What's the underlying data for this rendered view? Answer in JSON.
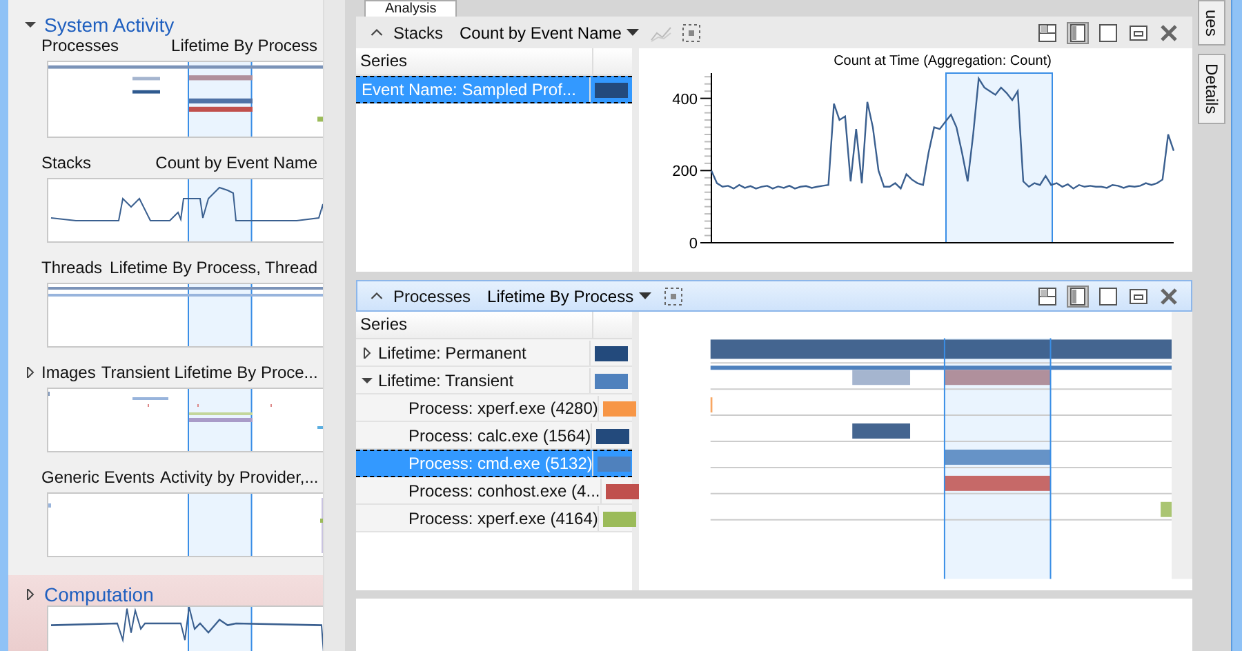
{
  "analysis_tab": {
    "label": "Analysis"
  },
  "graph_explorer": {
    "groups": [
      {
        "title": "System Activity",
        "expanded": true,
        "highlighted": false,
        "graphs": [
          {
            "kind": "processes",
            "title": "Processes",
            "preset": "Lifetime By Process",
            "expandable": false
          },
          {
            "kind": "stacks",
            "title": "Stacks",
            "preset": "Count by Event Name",
            "expandable": false
          },
          {
            "kind": "threads",
            "title": "Threads",
            "preset": "Lifetime By Process, Thread",
            "expandable": false
          },
          {
            "kind": "images",
            "title": "Images",
            "preset": "Transient Lifetime By Proce...",
            "expandable": true
          },
          {
            "kind": "events",
            "title": "Generic Events",
            "preset": "Activity by Provider,...",
            "expandable": false
          }
        ]
      },
      {
        "title": "Computation",
        "expanded": false,
        "highlighted": true,
        "preview": {
          "kind": "computation"
        }
      }
    ]
  },
  "stacks_panel": {
    "title": "Stacks",
    "preset": "Count by Event Name",
    "active": false,
    "table": {
      "column": "Series",
      "rows": [
        {
          "label": "Event Name: Sampled Prof...",
          "color": "#234a7c",
          "selected": true
        }
      ]
    },
    "chart_data": {
      "type": "line",
      "title": "Count at Time (Aggregation: Count)",
      "ylim": [
        0,
        470
      ],
      "yticks": [
        0,
        200,
        400
      ],
      "series": [
        {
          "color": "#3a5f8f",
          "values": [
            200,
            165,
            155,
            158,
            150,
            160,
            152,
            157,
            150,
            155,
            158,
            150,
            156,
            152,
            158,
            150,
            155,
            157,
            152,
            155,
            158,
            160,
            385,
            340,
            350,
            170,
            315,
            165,
            390,
            320,
            200,
            155,
            155,
            165,
            150,
            190,
            175,
            165,
            160,
            250,
            320,
            315,
            335,
            355,
            320,
            250,
            170,
            300,
            455,
            430,
            420,
            410,
            430,
            415,
            395,
            420,
            170,
            155,
            165,
            160,
            185,
            160,
            165,
            155,
            162,
            150,
            160,
            155,
            158,
            155,
            155,
            152,
            160,
            158,
            152,
            157,
            155,
            158,
            165,
            160,
            165,
            175,
            300,
            255
          ]
        }
      ]
    }
  },
  "processes_panel": {
    "title": "Processes",
    "preset": "Lifetime By Process",
    "active": true,
    "table": {
      "column": "Series",
      "rows": [
        {
          "label": "Lifetime: Permanent",
          "color": "#234a7c",
          "expanded": false,
          "selected": false,
          "children": []
        },
        {
          "label": "Lifetime: Transient",
          "color": "#4f81bd",
          "expanded": true,
          "selected": false,
          "children": [
            {
              "label": "Process: xperf.exe (4280)",
              "color": "#f79646",
              "selected": false
            },
            {
              "label": "Process: calc.exe (1564)",
              "color": "#234a7c",
              "selected": false
            },
            {
              "label": "Process: cmd.exe (5132)",
              "color": "#4f81bd",
              "selected": true
            },
            {
              "label": "Process: conhost.exe (4...",
              "color": "#c0504d",
              "selected": false
            },
            {
              "label": "Process: xperf.exe (4164)",
              "color": "#9bbb59",
              "selected": false
            }
          ]
        }
      ]
    }
  },
  "side_tabs": [
    {
      "label": "ues"
    },
    {
      "label": "Details"
    }
  ]
}
